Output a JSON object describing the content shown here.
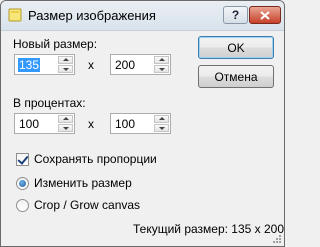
{
  "window": {
    "title": "Размер изображения",
    "help_label": "?",
    "close_label": "X"
  },
  "new_size": {
    "label": "Новый размер:",
    "width": "135",
    "height": "200",
    "separator": "x"
  },
  "percent": {
    "label": "В процентах:",
    "width": "100",
    "height": "100",
    "separator": "x"
  },
  "buttons": {
    "ok": "OK",
    "cancel": "Отмена"
  },
  "options": {
    "keep_proportions": "Сохранять пропорции",
    "keep_proportions_checked": true,
    "resize": "Изменить размер",
    "crop": "Crop / Grow canvas",
    "selected_mode": "resize"
  },
  "status": {
    "current_size": "Текущий размер: 135 x 200"
  },
  "colors": {
    "selection": "#3399ff",
    "close_button": "#c7412a",
    "default_button_border": "#3c7fb1"
  }
}
